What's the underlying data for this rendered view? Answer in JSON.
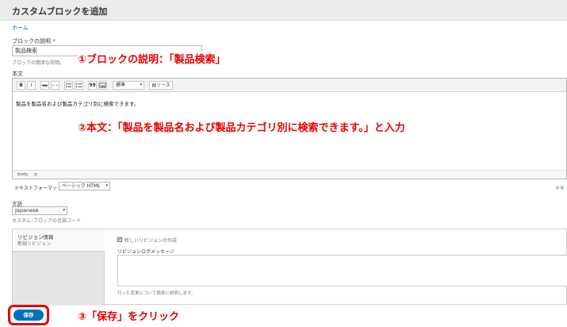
{
  "header": {
    "title": "カスタムブロックを追加",
    "favorite_icon": "star-outline-icon"
  },
  "breadcrumb": {
    "home": "ホーム"
  },
  "description_field": {
    "label": "ブロックの説明",
    "required_mark": "*",
    "value": "製品検索",
    "help": "ブロックの簡潔な説明。"
  },
  "body_field": {
    "label": "本文",
    "toolbar": {
      "bold": "B",
      "italic": "I",
      "link_icon": "link-icon",
      "unlink_icon": "unlink-icon",
      "bulleted_list_icon": "bulleted-list-icon",
      "numbered_list_icon": "numbered-list-icon",
      "blockquote": "99",
      "image_icon": "image-icon",
      "format_value": "標準",
      "source_label": "ソース"
    },
    "content": "製品を製品名および製品カテゴリ別に検索できます。",
    "status_path": [
      "body",
      "p"
    ]
  },
  "text_format": {
    "label": "テキストフォーマット",
    "value": "ベーシック HTML",
    "help_link": "テキ"
  },
  "language": {
    "label": "言語",
    "value": "Japanese",
    "help": "カスタム･ブロックの言語コード"
  },
  "revision": {
    "tab_title": "リビジョン情報",
    "tab_summary": "新規リビジョン",
    "checkbox_label": "新しいリビジョンの作成",
    "checkbox_checked": true,
    "log_label": "リビジョンログメッセージ",
    "log_value": "",
    "log_help": "行った変更について簡単に説明します。"
  },
  "save_button": {
    "label": "保存",
    "color": "#0072b9"
  },
  "annotations": {
    "step1": "①ブロックの説明：「製品検索」",
    "step2": "②本文：「製品を製品名および製品カテゴリ別に検索できます。」と入力",
    "step3": "③「保存」をクリック",
    "color": "#e60000"
  }
}
